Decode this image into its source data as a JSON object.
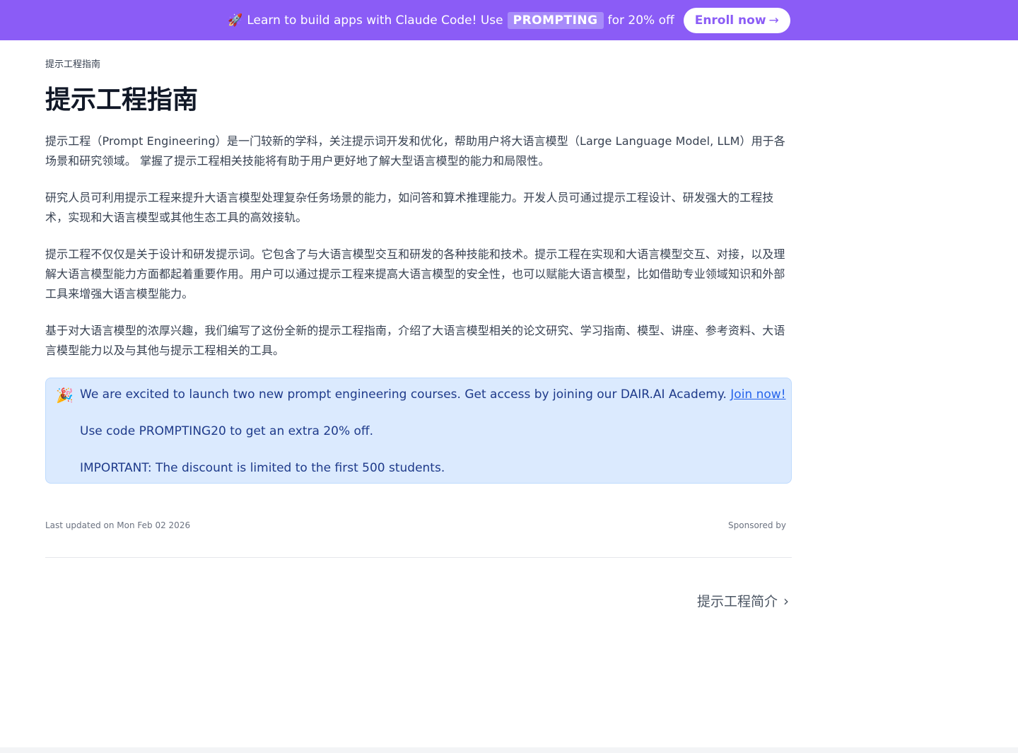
{
  "banner": {
    "rocket_icon": "rocket-icon",
    "text_before": "Learn to build apps with Claude Code! Use",
    "code": "PROMPTING",
    "text_after": "for 20% off",
    "enroll_label": "Enroll now",
    "enroll_arrow": "→",
    "background": "#8b5cf6"
  },
  "breadcrumb": "提示工程指南",
  "page_title": "提示工程指南",
  "paragraphs": [
    "提示工程（Prompt Engineering）是一门较新的学科，关注提示词开发和优化，帮助用户将大语言模型（Large Language Model, LLM）用于各场景和研究领域。 掌握了提示工程相关技能将有助于用户更好地了解大型语言模型的能力和局限性。",
    "研究人员可利用提示工程来提升大语言模型处理复杂任务场景的能力，如问答和算术推理能力。开发人员可通过提示工程设计、研发强大的工程技术，实现和大语言模型或其他生态工具的高效接轨。",
    "提示工程不仅仅是关于设计和研发提示词。它包含了与大语言模型交互和研发的各种技能和技术。提示工程在实现和大语言模型交互、对接，以及理解大语言模型能力方面都起着重要作用。用户可以通过提示工程来提高大语言模型的安全性，也可以赋能大语言模型，比如借助专业领域知识和外部工具来增强大语言模型能力。",
    "基于对大语言模型的浓厚兴趣，我们编写了这份全新的提示工程指南，介绍了大语言模型相关的论文研究、学习指南、模型、讲座、参考资料、大语言模型能力以及与其他与提示工程相关的工具。"
  ],
  "callout": {
    "icon": "party-popper-icon",
    "line1": "We are excited to launch two new prompt engineering courses. Get access by joining our DAIR.AI Academy.",
    "link": "Join now!",
    "line2": "Use code PROMPTING20 to get an extra 20% off.",
    "line3": "IMPORTANT: The discount is limited to the first 500 students."
  },
  "footer": {
    "last_updated": "Last updated on Mon Feb 02 2026",
    "sponsored": "Sponsored by"
  },
  "next_page": {
    "label": "提示工程简介",
    "chevron": "›"
  }
}
